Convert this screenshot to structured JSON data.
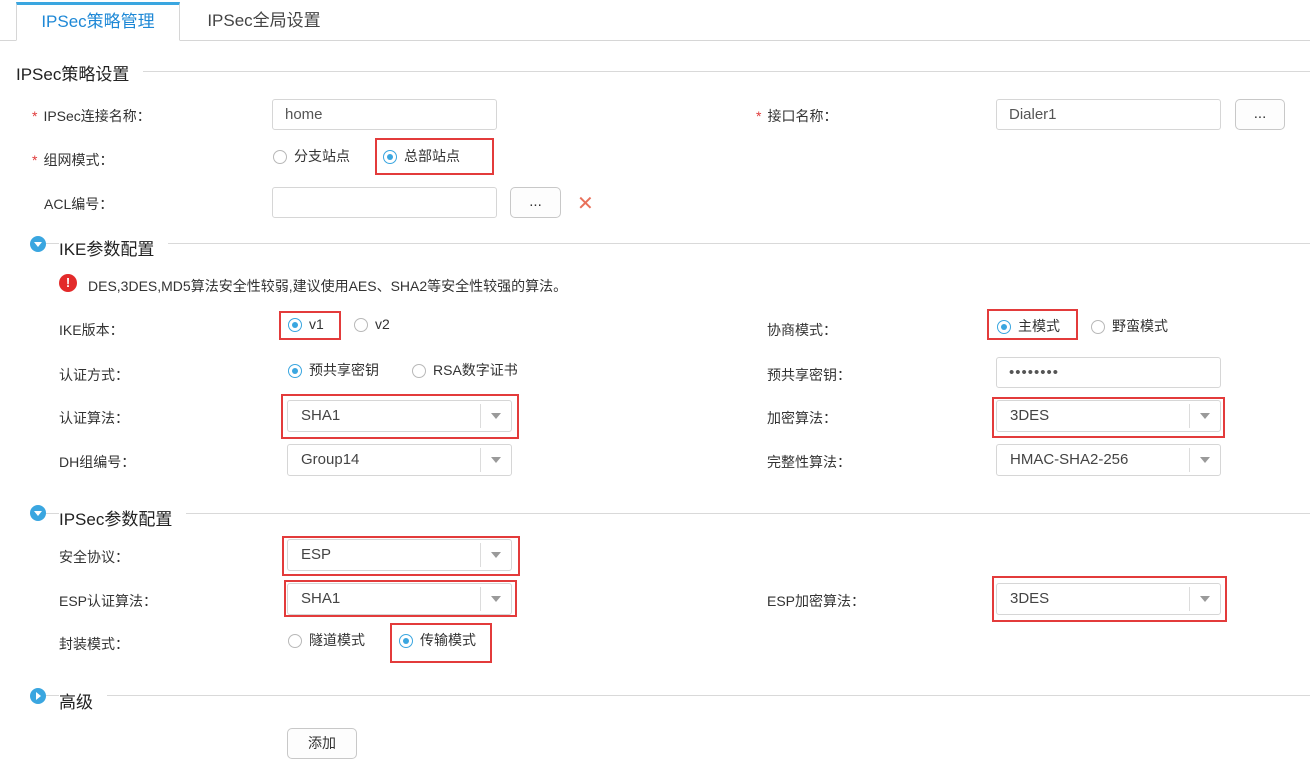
{
  "tabs": [
    {
      "label": "IPSec策略管理",
      "active": true
    },
    {
      "label": "IPSec全局设置",
      "active": false
    }
  ],
  "policy_section": {
    "title": "IPSec策略设置",
    "connection_name_label": "IPSec连接名称：",
    "connection_name_value": "home",
    "interface_label": "接口名称：",
    "interface_value": "Dialer1",
    "browse_label": "...",
    "network_mode_label": "组网模式：",
    "network_mode_options": [
      "分支站点",
      "总部站点"
    ],
    "network_mode_selected": "总部站点",
    "acl_label": "ACL编号：",
    "acl_value": "",
    "acl_browse_label": "...",
    "acl_clear_glyph": "✕",
    "required_mark": "*"
  },
  "ike_section": {
    "title": "IKE参数配置",
    "warning_icon": "!",
    "warning": "DES,3DES,MD5算法安全性较弱,建议使用AES、SHA2等安全性较强的算法。",
    "version_label": "IKE版本：",
    "version_options": [
      "v1",
      "v2"
    ],
    "version_selected": "v1",
    "negotiation_label": "协商模式：",
    "negotiation_options": [
      "主模式",
      "野蛮模式"
    ],
    "negotiation_selected": "主模式",
    "auth_method_label": "认证方式：",
    "auth_method_options": [
      "预共享密钥",
      "RSA数字证书"
    ],
    "auth_method_selected": "预共享密钥",
    "psk_label": "预共享密钥：",
    "psk_value": "••••••••",
    "auth_alg_label": "认证算法：",
    "auth_alg_value": "SHA1",
    "enc_alg_label": "加密算法：",
    "enc_alg_value": "3DES",
    "dh_label": "DH组编号：",
    "dh_value": "Group14",
    "integrity_label": "完整性算法：",
    "integrity_value": "HMAC-SHA2-256"
  },
  "ipsec_section": {
    "title": "IPSec参数配置",
    "protocol_label": "安全协议：",
    "protocol_value": "ESP",
    "esp_auth_label": "ESP认证算法：",
    "esp_auth_value": "SHA1",
    "esp_enc_label": "ESP加密算法：",
    "esp_enc_value": "3DES",
    "encap_label": "封装模式：",
    "encap_options": [
      "隧道模式",
      "传输模式"
    ],
    "encap_selected": "传输模式"
  },
  "advanced_section": {
    "title": "高级"
  },
  "add_button": "添加",
  "colors": {
    "accent": "#3aa6e0",
    "highlight": "#e33b3b",
    "required": "#e03a3a"
  }
}
